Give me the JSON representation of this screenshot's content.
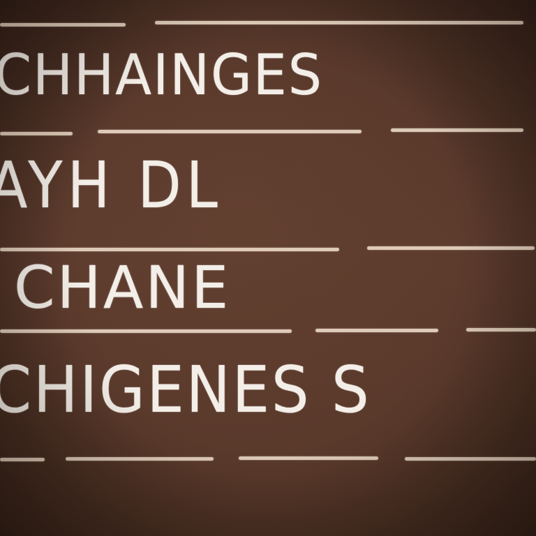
{
  "chalkboard": {
    "lines": [
      "CHHAINGES",
      "AYH DL",
      "CHANE",
      "CHIGENES S"
    ]
  },
  "colors": {
    "board": "#5a3a2c",
    "chalk": "#f3eee8",
    "rule": "#e9d7c4"
  }
}
